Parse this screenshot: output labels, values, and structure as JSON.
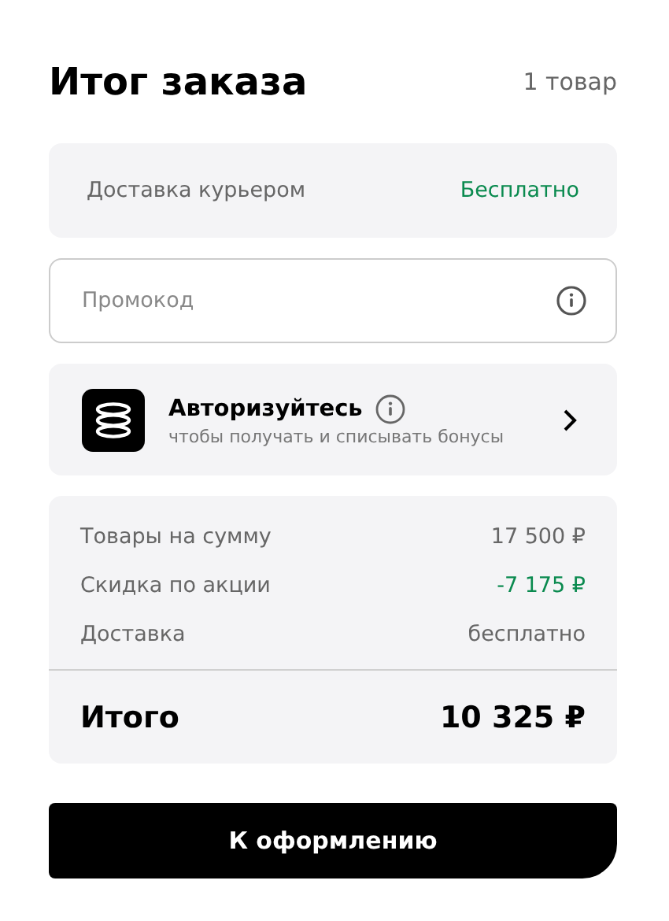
{
  "header": {
    "title": "Итог заказа",
    "count": "1 товар"
  },
  "delivery": {
    "label": "Доставка курьером",
    "value": "Бесплатно"
  },
  "promo": {
    "placeholder": "Промокод"
  },
  "auth": {
    "title": "Авторизуйтесь",
    "subtitle": "чтобы получать и списывать бонусы"
  },
  "summary": {
    "rows": [
      {
        "label": "Товары на сумму",
        "value": "17 500 ₽",
        "kind": "normal"
      },
      {
        "label": "Скидка по акции",
        "value": "-7 175 ₽",
        "kind": "discount"
      },
      {
        "label": "Доставка",
        "value": "бесплатно",
        "kind": "normal"
      }
    ],
    "total_label": "Итого",
    "total_value": "10 325 ₽"
  },
  "checkout_button": "К оформлению"
}
